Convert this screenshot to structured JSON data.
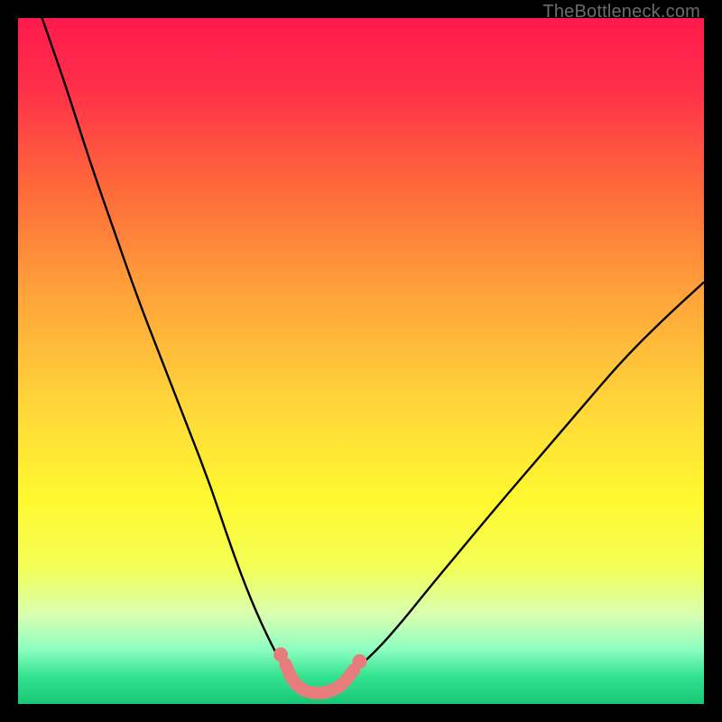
{
  "watermark": "TheBottleneck.com",
  "chart_data": {
    "type": "line",
    "title": "",
    "xlabel": "",
    "ylabel": "",
    "xlim": [
      0,
      1
    ],
    "ylim": [
      0,
      1
    ],
    "gradient_stops": [
      {
        "offset": 0.0,
        "color": "#ff1a4d"
      },
      {
        "offset": 0.1,
        "color": "#ff2f4a"
      },
      {
        "offset": 0.25,
        "color": "#ff6a3a"
      },
      {
        "offset": 0.4,
        "color": "#ffa23a"
      },
      {
        "offset": 0.55,
        "color": "#ffd23a"
      },
      {
        "offset": 0.7,
        "color": "#fff82f"
      },
      {
        "offset": 0.8,
        "color": "#f3ff55"
      },
      {
        "offset": 0.87,
        "color": "#d8ffb0"
      },
      {
        "offset": 0.92,
        "color": "#8dffc0"
      },
      {
        "offset": 0.96,
        "color": "#33e28f"
      },
      {
        "offset": 1.0,
        "color": "#18c877"
      }
    ],
    "series": [
      {
        "name": "left-branch",
        "stroke": "#000000",
        "stroke_width": 2.4,
        "x": [
          0.035,
          0.07,
          0.105,
          0.14,
          0.175,
          0.21,
          0.245,
          0.28,
          0.31,
          0.34,
          0.37,
          0.395
        ],
        "y": [
          1.0,
          0.9,
          0.79,
          0.69,
          0.59,
          0.5,
          0.41,
          0.32,
          0.23,
          0.15,
          0.085,
          0.04
        ]
      },
      {
        "name": "right-branch",
        "stroke": "#000000",
        "stroke_width": 2.4,
        "x": [
          0.48,
          0.52,
          0.56,
          0.6,
          0.65,
          0.7,
          0.76,
          0.82,
          0.88,
          0.94,
          1.0
        ],
        "y": [
          0.04,
          0.075,
          0.12,
          0.17,
          0.23,
          0.29,
          0.36,
          0.43,
          0.5,
          0.56,
          0.615
        ]
      },
      {
        "name": "valley-marker",
        "stroke": "#e77c7c",
        "stroke_width": 14,
        "linecap": "round",
        "x": [
          0.39,
          0.4,
          0.415,
          0.43,
          0.445,
          0.46,
          0.475,
          0.49
        ],
        "y": [
          0.058,
          0.034,
          0.02,
          0.016,
          0.016,
          0.02,
          0.03,
          0.05
        ]
      }
    ],
    "scatter": [
      {
        "name": "valley-dots",
        "fill": "#e77c7c",
        "r": 8,
        "points": [
          {
            "x": 0.383,
            "y": 0.072
          },
          {
            "x": 0.498,
            "y": 0.062
          }
        ]
      }
    ]
  }
}
